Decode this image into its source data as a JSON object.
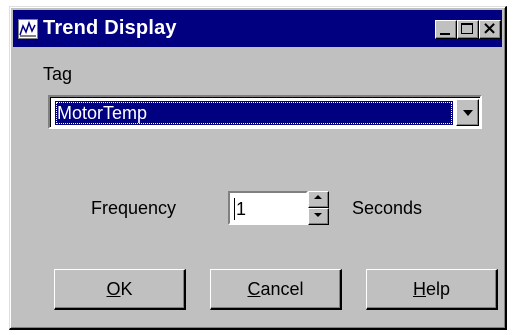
{
  "window": {
    "title": "Trend Display",
    "icon": "trend-chart-icon",
    "controls": {
      "minimize": "minimize-icon",
      "maximize": "maximize-icon",
      "close": "close-icon"
    }
  },
  "tag": {
    "label": "Tag",
    "selected": "MotorTemp"
  },
  "frequency": {
    "label": "Frequency",
    "value": "1",
    "unit": "Seconds"
  },
  "buttons": {
    "ok": {
      "accel": "O",
      "rest": "K"
    },
    "cancel": {
      "accel": "C",
      "rest": "ancel"
    },
    "help": {
      "accel": "H",
      "rest": "elp"
    }
  },
  "colors": {
    "titlebar": "#000080",
    "face": "#c0c0c0",
    "selection": "#000080"
  }
}
